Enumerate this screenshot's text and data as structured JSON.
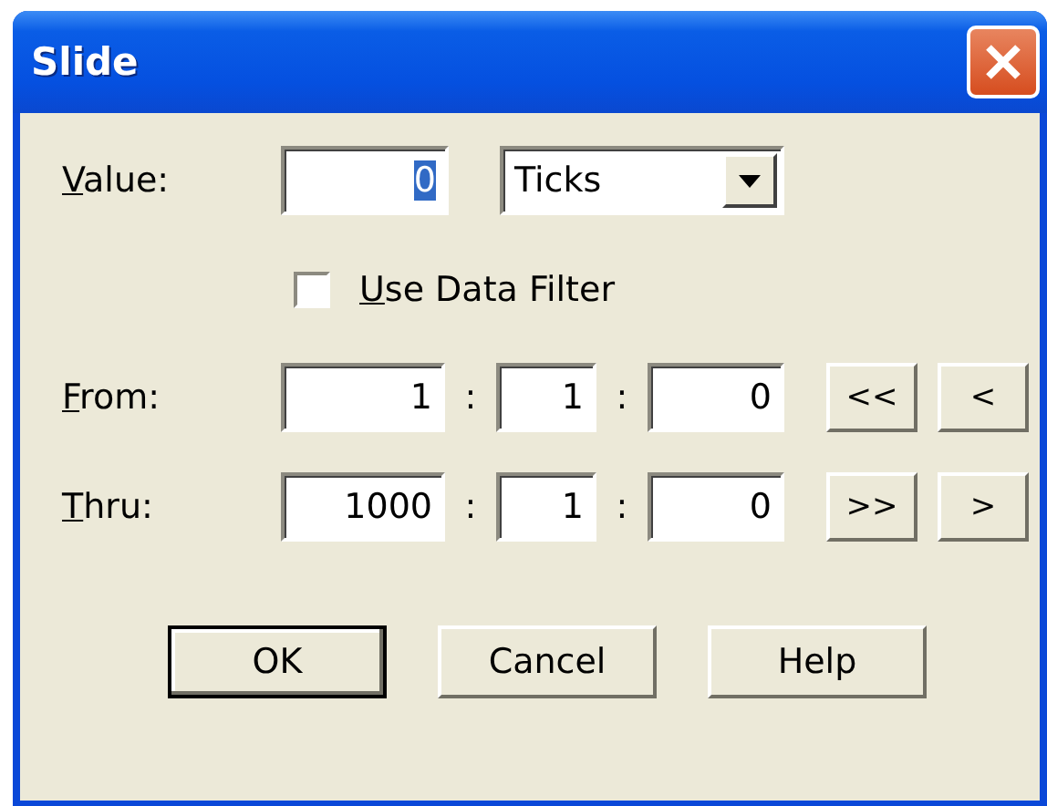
{
  "window": {
    "title": "Slide"
  },
  "value": {
    "label": "Value:",
    "field": "0",
    "text_selected": true,
    "unit": "Ticks"
  },
  "filter": {
    "label": "Use Data Filter",
    "checked": false
  },
  "ranges": [
    {
      "label": "From:",
      "parts": [
        "1",
        "1",
        "0"
      ],
      "separators": [
        ":",
        ":"
      ],
      "buttons": [
        "<<",
        "<"
      ]
    },
    {
      "label": "Thru:",
      "parts": [
        "1000",
        "1",
        "0"
      ],
      "separators": [
        ":",
        ":"
      ],
      "buttons": [
        ">>",
        ">"
      ]
    }
  ],
  "buttons": [
    {
      "label": "OK",
      "default": true
    },
    {
      "label": "Cancel",
      "default": false
    },
    {
      "label": "Help",
      "default": false
    }
  ]
}
